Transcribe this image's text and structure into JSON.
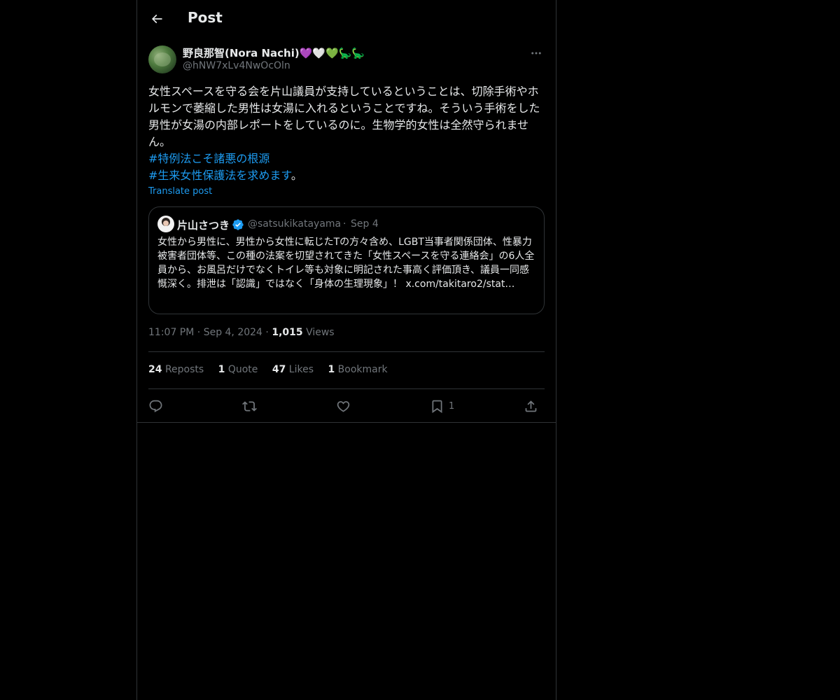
{
  "header": {
    "title": "Post"
  },
  "author": {
    "name": "野良那智(Nora Nachi)💜🤍💚🦕🦕",
    "handle": "@hNW7xLv4NwOcOln"
  },
  "post": {
    "text_1": "女性スペースを守る会を片山議員が支持しているということは、切除手術やホルモンで萎縮した男性は女湯に入れるということですね。そういう手術をした男性が女湯の内部レポートをしているのに。生物学的女性は全然守られません。",
    "hashtag_1": "#特例法こそ諸悪の根源",
    "hashtag_2": "#生来女性保護法を求めます",
    "text_end": "。",
    "translate_label": "Translate post"
  },
  "quote": {
    "name": "片山さつき",
    "handle": "@satsukikatayama",
    "separator": "·",
    "date": "Sep 4",
    "text": "女性から男性に、男性から女性に転じたTの方々含め、LGBT当事者関係団体、性暴力被害者団体等、この種の法案を切望されてきた「女性スペースを守る連絡会」の6人全員から、お風呂だけでなくトイレ等も対象に明記された事高く評価頂き、議員一同感慨深く。排泄は「認識」ではなく「身体の生理現象」！ x.com/takitaro2/stat…"
  },
  "meta": {
    "time": "11:07 PM",
    "sep": "·",
    "date": "Sep 4, 2024",
    "views_count": "1,015",
    "views_label": "Views"
  },
  "stats": {
    "reposts_count": "24",
    "reposts_label": "Reposts",
    "quotes_count": "1",
    "quotes_label": "Quote",
    "likes_count": "47",
    "likes_label": "Likes",
    "bookmarks_count": "1",
    "bookmarks_label": "Bookmark"
  },
  "actions": {
    "bookmark_count": "1"
  },
  "icons": {
    "back": "arrow-left-icon",
    "more": "more-horizontal-icon",
    "verified": "verified-badge-icon",
    "reply": "reply-icon",
    "repost": "repost-icon",
    "like": "heart-icon",
    "bookmark": "bookmark-icon",
    "share": "share-icon"
  },
  "colors": {
    "background": "#000000",
    "text": "#e7e9ea",
    "muted": "#71767b",
    "accent": "#1d9bf0",
    "border": "#2f3336"
  }
}
